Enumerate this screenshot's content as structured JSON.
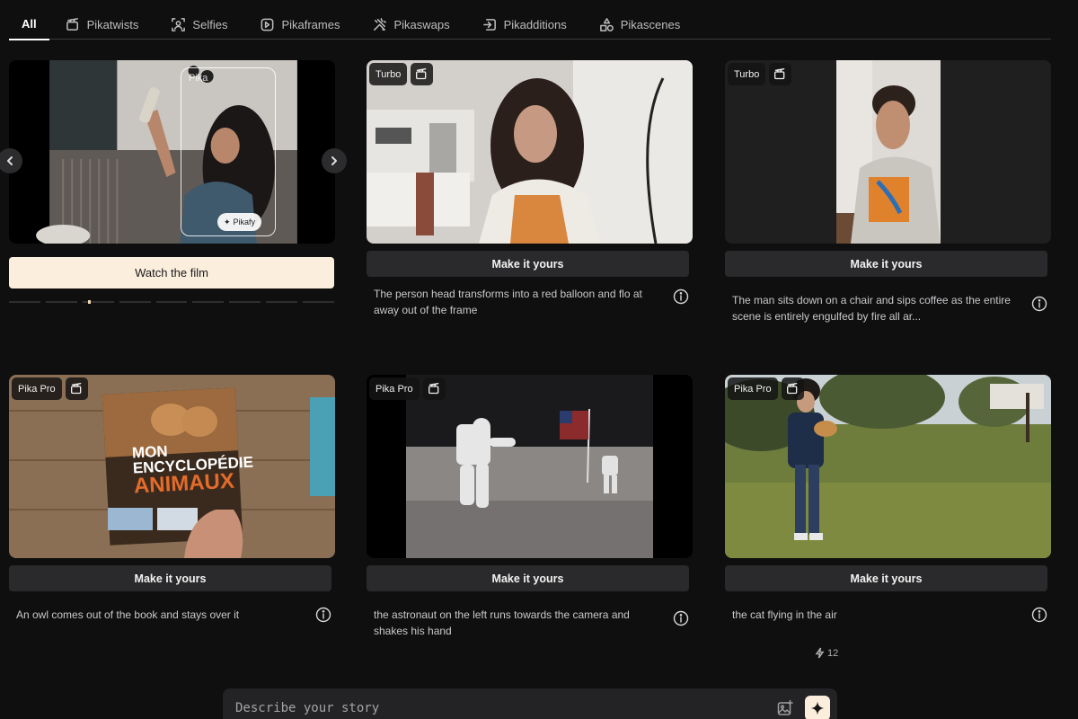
{
  "tabs": [
    {
      "label": "All",
      "icon": "none",
      "active": true
    },
    {
      "label": "Pikatwists",
      "icon": "twist-icon"
    },
    {
      "label": "Selfies",
      "icon": "selfie-icon"
    },
    {
      "label": "Pikaframes",
      "icon": "frames-icon"
    },
    {
      "label": "Pikaswaps",
      "icon": "swap-icon"
    },
    {
      "label": "Pikadditions",
      "icon": "additions-icon"
    },
    {
      "label": "Pikascenes",
      "icon": "scenes-icon"
    }
  ],
  "featured": {
    "watch_label": "Watch the film",
    "overlay_text": "Pika",
    "chip_label": "Pikafy",
    "dot_count": 9,
    "active_dot": 2
  },
  "cards": [
    {
      "badge": "Turbo",
      "button": "Make it yours",
      "description": "The person head transforms into a red balloon and flo at away out of the frame"
    },
    {
      "badge": "Turbo",
      "button": "Make it yours",
      "description": "The man sits down on a chair and sips coffee as the entire scene is entirely engulfed by fire all ar..."
    },
    {
      "badge": "Pika Pro",
      "button": "Make it yours",
      "description": "An owl comes out of the book and stays over it"
    },
    {
      "badge": "Pika Pro",
      "button": "Make it yours",
      "description": "the astronaut on the left runs towards the camera and shakes his hand"
    },
    {
      "badge": "Pika Pro",
      "button": "Make it yours",
      "description": "the cat flying in the air"
    }
  ],
  "book": {
    "line1": "MON",
    "line2": "ENCYCLOPÉDIE",
    "line3": "ANIMAUX"
  },
  "counter": "12",
  "prompt": {
    "placeholder": "Describe your story"
  },
  "colors": {
    "accent": "#fbeedd",
    "background": "#0f0f10",
    "button": "#2a2a2c"
  }
}
